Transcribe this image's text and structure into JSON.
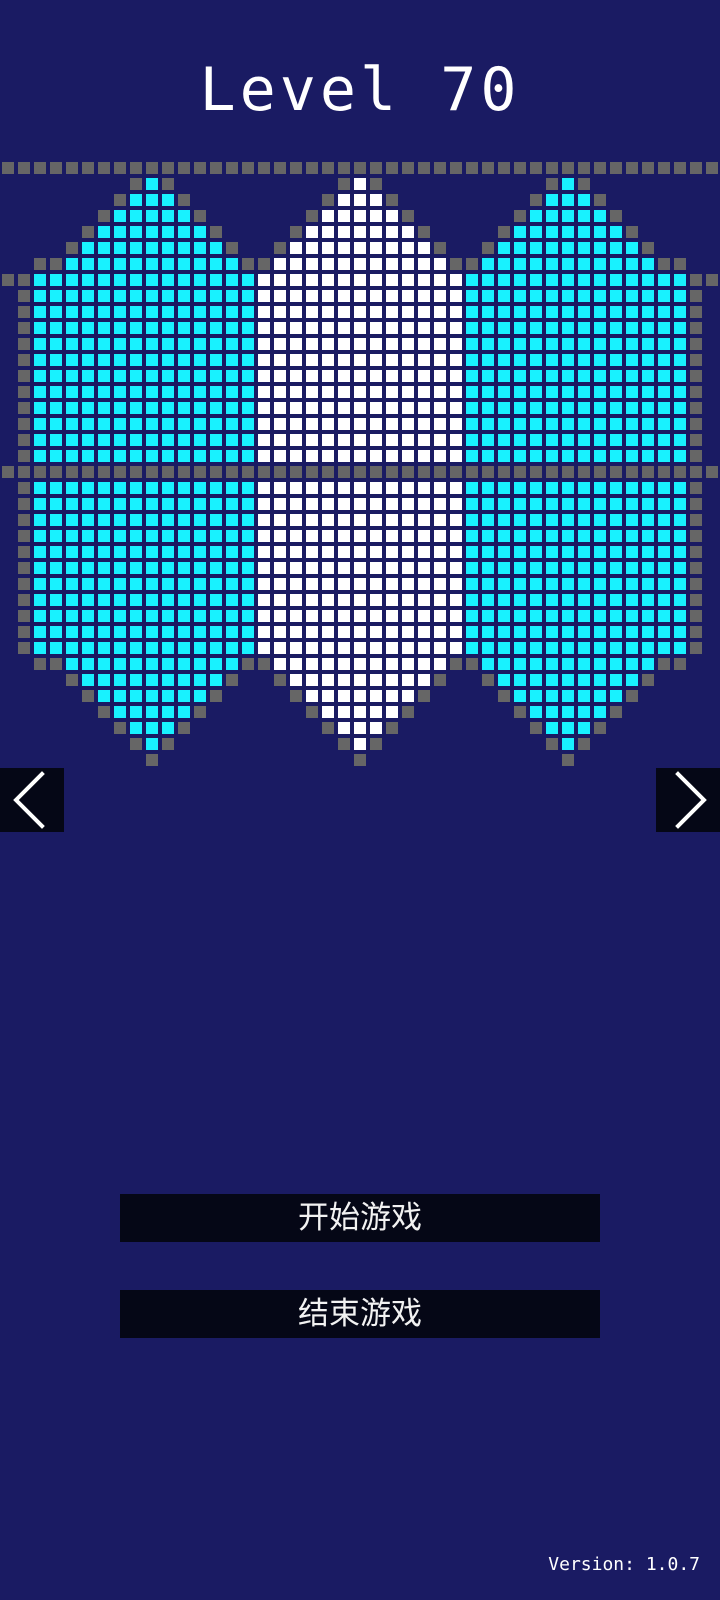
{
  "level": {
    "title": "Level 70"
  },
  "board": {
    "colors": {
      "background": "#1a1b63",
      "border_gray": "#666666",
      "cyan_fill": "#18f2ff",
      "white_fill": "#ffffff"
    },
    "panels": [
      {
        "name": "left",
        "fill": "cyan"
      },
      {
        "name": "center",
        "fill": "white"
      },
      {
        "name": "right",
        "fill": "cyan"
      }
    ]
  },
  "navigation": {
    "prev_icon": "chevron-left-icon",
    "next_icon": "chevron-right-icon"
  },
  "menu": {
    "start_label": "开始游戏",
    "quit_label": "结束游戏"
  },
  "footer": {
    "version": "Version: 1.0.7"
  }
}
